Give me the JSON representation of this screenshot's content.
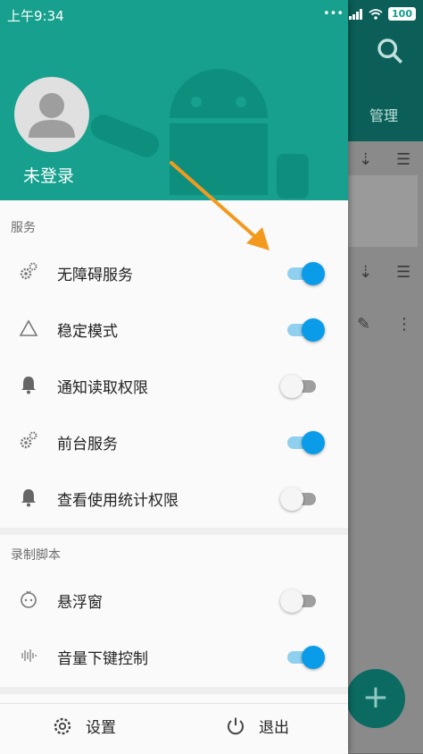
{
  "status_bar": {
    "time": "上午9:34",
    "battery": "100"
  },
  "drawer": {
    "user": {
      "name": "未登录"
    },
    "sections": [
      {
        "title": "服务",
        "items": [
          {
            "label": "无障碍服务",
            "icon": "gears-icon",
            "on": true
          },
          {
            "label": "稳定模式",
            "icon": "triangle-icon",
            "on": true
          },
          {
            "label": "通知读取权限",
            "icon": "bell-icon",
            "on": false
          },
          {
            "label": "前台服务",
            "icon": "gears-icon",
            "on": true
          },
          {
            "label": "查看使用统计权限",
            "icon": "bell-icon",
            "on": false
          }
        ]
      },
      {
        "title": "录制脚本",
        "items": [
          {
            "label": "悬浮窗",
            "icon": "floating-face-icon",
            "on": false
          },
          {
            "label": "音量下键控制",
            "icon": "sound-wave-icon",
            "on": true
          }
        ]
      }
    ],
    "footer": {
      "settings": "设置",
      "exit": "退出"
    }
  },
  "background": {
    "tab_label": "管理"
  },
  "colors": {
    "header": "#16a08d",
    "switch_on": "#0a9ce9",
    "arrow": "#f39a1e"
  }
}
